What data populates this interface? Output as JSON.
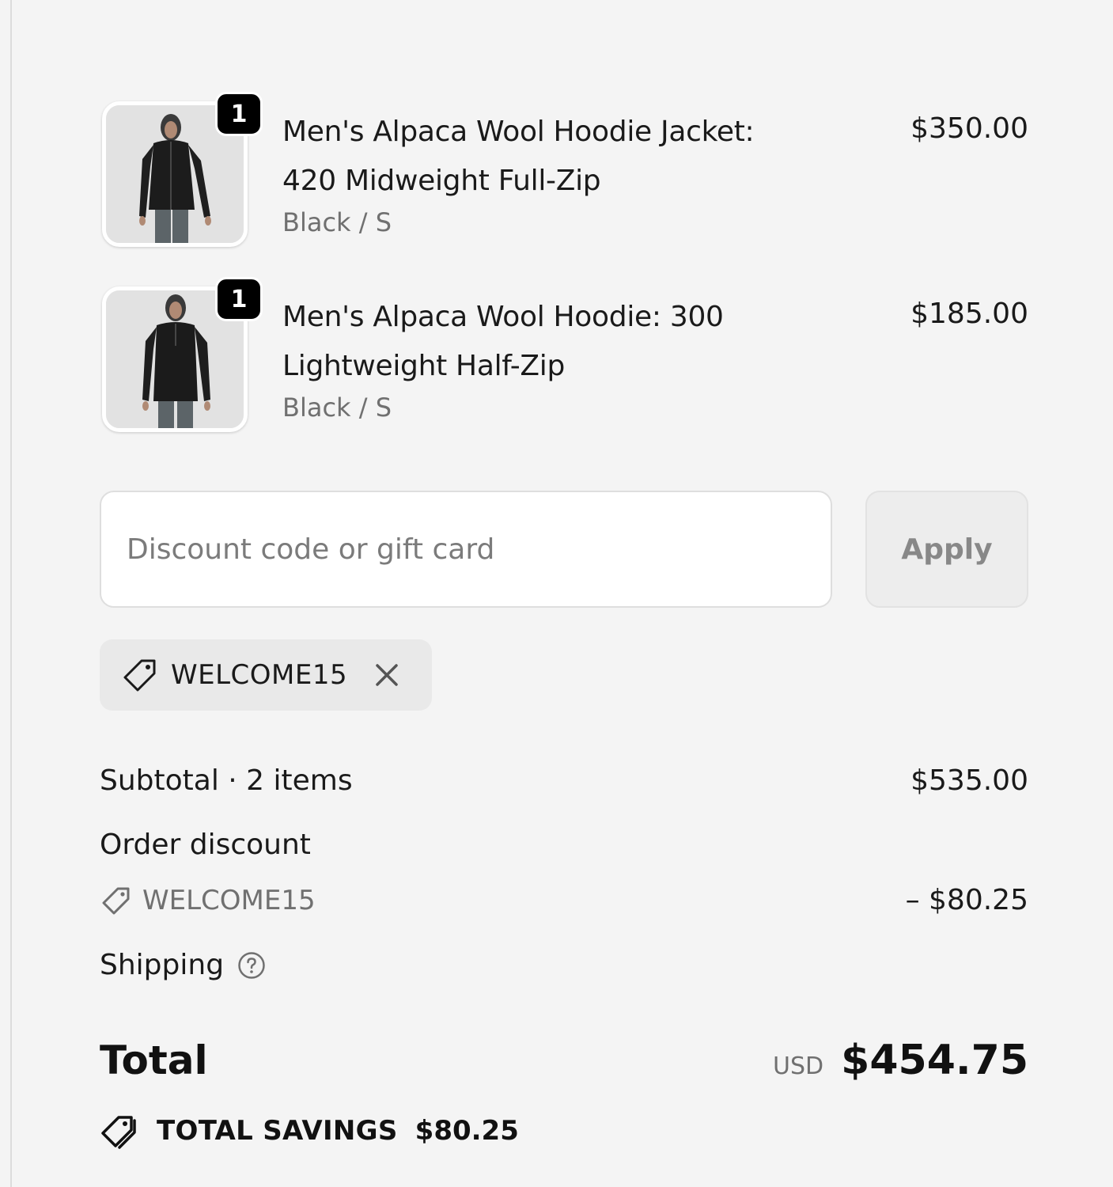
{
  "line_items": [
    {
      "quantity": "1",
      "title_line1": "Men's Alpaca Wool Hoodie Jacket:",
      "title_line2": "420 Midweight Full-Zip",
      "variant": "Black / S",
      "price": "$350.00",
      "image": "man-in-black-full-zip-hoodie-photo"
    },
    {
      "quantity": "1",
      "title_line1": "Men's Alpaca Wool Hoodie: 300",
      "title_line2": "Lightweight Half-Zip",
      "variant": "Black / S",
      "price": "$185.00",
      "image": "man-in-black-half-zip-hoodie-photo"
    }
  ],
  "discount": {
    "placeholder": "Discount code or gift card",
    "value": "",
    "apply_label": "Apply",
    "applied_code": "WELCOME15"
  },
  "summary": {
    "subtotal_label": "Subtotal · 2 items",
    "subtotal_value": "$535.00",
    "order_discount_label": "Order discount",
    "order_discount_code": "WELCOME15",
    "order_discount_value": "– $80.25",
    "shipping_label": "Shipping",
    "total_label": "Total",
    "total_currency": "USD",
    "total_value": "$454.75",
    "savings_label": "TOTAL SAVINGS",
    "savings_value": "$80.25"
  },
  "icons": {
    "tag": "tag-icon",
    "remove": "close-icon",
    "help": "question-circle-icon",
    "savings": "double-tag-icon"
  },
  "colors": {
    "background": "#f4f4f4",
    "text": "#1a1a1a",
    "muted": "#707070",
    "badge": "#000000",
    "button_disabled": "#ededed"
  }
}
